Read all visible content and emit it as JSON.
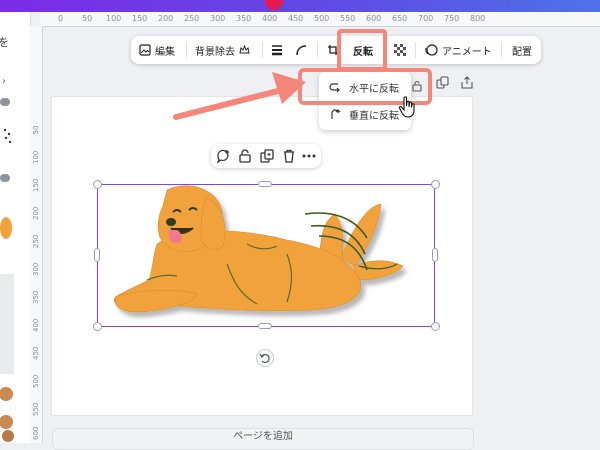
{
  "toolbar": {
    "edit_label": "編集",
    "bg_remove_label": "背景除去",
    "flip_label": "反転",
    "animate_label": "アニメート",
    "position_label": "配置"
  },
  "flip_menu": {
    "horizontal_label": "水平に反転",
    "vertical_label": "垂直に反転"
  },
  "left_panel": {
    "top_label": "を"
  },
  "ruler_top": [
    "0",
    "50",
    "100",
    "150",
    "200",
    "250",
    "300",
    "350",
    "400",
    "450",
    "500",
    "550",
    "600",
    "650",
    "700",
    "750",
    "800"
  ],
  "ruler_left": [
    "50",
    "100",
    "150",
    "200",
    "250",
    "300",
    "350",
    "400",
    "450",
    "500",
    "550",
    "600"
  ],
  "bottom_bar": {
    "label": "ページを追加"
  },
  "colors": {
    "accent": "#8b3dff",
    "highlight": "#f4877a",
    "dog": "#f2a23c"
  }
}
